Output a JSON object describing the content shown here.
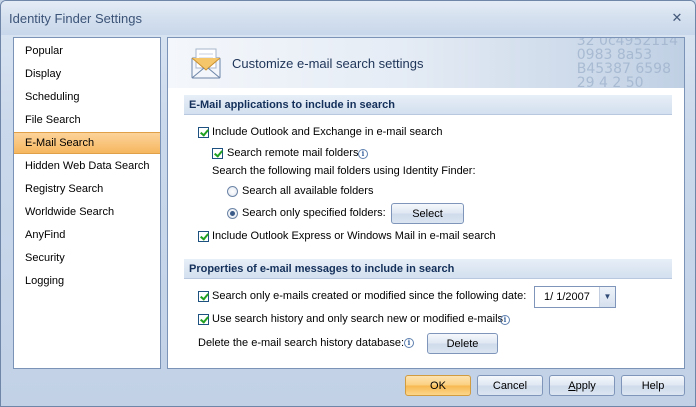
{
  "window": {
    "title": "Identity Finder Settings",
    "close_glyph": "✕"
  },
  "nav": {
    "items": [
      {
        "label": "Popular"
      },
      {
        "label": "Display"
      },
      {
        "label": "Scheduling"
      },
      {
        "label": "File Search"
      },
      {
        "label": "E-Mail Search",
        "selected": true
      },
      {
        "label": "Hidden Web Data Search"
      },
      {
        "label": "Registry Search"
      },
      {
        "label": "Worldwide Search"
      },
      {
        "label": "AnyFind"
      },
      {
        "label": "Security"
      },
      {
        "label": "Logging"
      }
    ]
  },
  "banner": {
    "heading": "Customize e-mail search settings",
    "icon": "envelope-icon",
    "decor_numbers": [
      "32  0c4952114",
      "0983   8a53",
      "B45387  6598",
      "29  4 2  50"
    ]
  },
  "section1": {
    "title": "E-Mail applications to include in search",
    "include_outlook": {
      "label": "Include Outlook and Exchange in e-mail search",
      "checked": true
    },
    "search_remote": {
      "label": "Search remote mail folders",
      "checked": true
    },
    "following_text": "Search the following mail folders using Identity Finder:",
    "radio_all": {
      "label": "Search all available folders",
      "selected": false
    },
    "radio_specified": {
      "label": "Search only specified folders:",
      "selected": true
    },
    "select_button": "Select",
    "include_express": {
      "label": "Include Outlook Express or Windows Mail in e-mail search",
      "checked": true
    }
  },
  "section2": {
    "title": "Properties of e-mail messages to include in search",
    "only_since": {
      "label": "Search only e-mails created or modified since the following date:",
      "checked": true
    },
    "date_value": "1/  1/2007",
    "use_history": {
      "label": "Use search history and only search new or modified e-mails",
      "checked": true
    },
    "delete_text": "Delete the e-mail search history database:",
    "delete_button": "Delete"
  },
  "footer": {
    "ok": "OK",
    "cancel": "Cancel",
    "apply_underlined": "A",
    "apply_rest": "pply",
    "help": "Help"
  },
  "colors": {
    "selected_nav": "#f6b75e",
    "section_title": "#14305a",
    "primary_button": "#fbcf7f",
    "frame": "#c5d3e6"
  }
}
